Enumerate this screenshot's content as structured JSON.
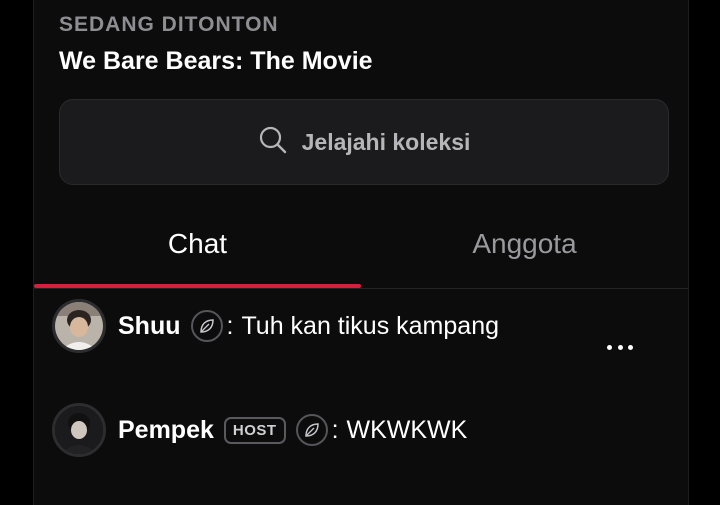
{
  "now_playing": {
    "label": "SEDANG DITONTON",
    "title": "We Bare Bears: The Movie"
  },
  "search": {
    "icon": "search-icon",
    "text": "Jelajahi koleksi"
  },
  "tabs": [
    {
      "label": "Chat",
      "active": true
    },
    {
      "label": "Anggota",
      "active": false
    }
  ],
  "colors": {
    "accent": "#d3213c",
    "background": "#0c0c0d"
  },
  "messages": [
    {
      "name": "Shuu",
      "host": null,
      "badge_icon": "leaf-icon",
      "separator": ":",
      "text": "Tuh kan tikus kampang"
    },
    {
      "name": "Pempek",
      "host": "HOST",
      "badge_icon": "leaf-icon",
      "separator": ":",
      "text": "WKWKWK"
    }
  ],
  "more_icon": "more-dots-icon"
}
